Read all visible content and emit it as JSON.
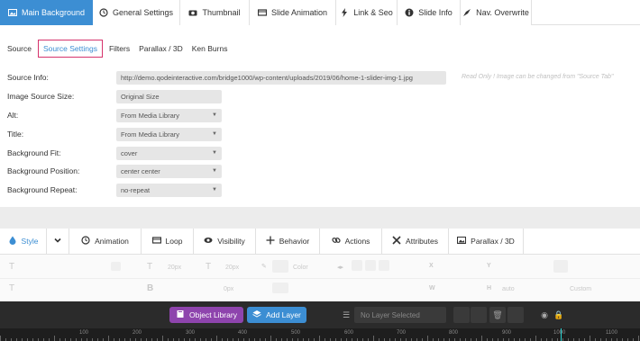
{
  "top_tabs": [
    {
      "label": "Main Background",
      "icon": "image-icon",
      "width": 103,
      "active": true
    },
    {
      "label": "General Settings",
      "icon": "history-icon",
      "width": 97
    },
    {
      "label": "Thumbnail",
      "icon": "camera-icon",
      "width": 77
    },
    {
      "label": "Slide Animation",
      "icon": "film-icon",
      "width": 96
    },
    {
      "label": "Link & Seo",
      "icon": "bolt-icon",
      "width": 68
    },
    {
      "label": "Slide Info",
      "icon": "info-icon",
      "width": 70
    },
    {
      "label": "Nav. Overwrite",
      "icon": "compass-icon",
      "width": 79
    }
  ],
  "sub_tabs": [
    "Source",
    "Source Settings",
    "Filters",
    "Parallax / 3D",
    "Ken Burns"
  ],
  "source_info": {
    "label": "Source Info:",
    "value": "http://demo.qodeinteractive.com/bridge1000/wp-content/uploads/2019/06/home-1-slider-img-1.jpg",
    "note": "Read Only ! Image can be changed from \"Source Tab\""
  },
  "fields": [
    {
      "label": "Image Source Size:",
      "value": "Original Size"
    },
    {
      "label": "Alt:",
      "value": "From Media Library"
    },
    {
      "label": "Title:",
      "value": "From Media Library"
    },
    {
      "label": "Background Fit:",
      "value": "cover"
    },
    {
      "label": "Background Position:",
      "value": "center center"
    },
    {
      "label": "Background Repeat:",
      "value": "no-repeat"
    }
  ],
  "layer_tabs": [
    {
      "label": "Style",
      "icon": "drop-icon",
      "active": true
    },
    {
      "label": "",
      "icon": "chevron-down-icon"
    },
    {
      "label": "Animation",
      "icon": "history-icon"
    },
    {
      "label": "Loop",
      "icon": "film-icon"
    },
    {
      "label": "Visibility",
      "icon": "eye-icon"
    },
    {
      "label": "Behavior",
      "icon": "move-icon"
    },
    {
      "label": "Actions",
      "icon": "link-icon"
    },
    {
      "label": "Attributes",
      "icon": "tools-icon"
    },
    {
      "label": "Parallax / 3D",
      "icon": "image-icon"
    }
  ],
  "toolbar_faded": {
    "size": "20px",
    "color": "Color",
    "x": "X",
    "y": "Y",
    "b": "B",
    "w": "W",
    "h": "H",
    "zero": "0px",
    "auto": "auto",
    "custom": "Custom"
  },
  "bottom_bar": {
    "object_library": "Object Library",
    "add_layer": "Add Layer",
    "layer_select": "No Layer Selected"
  },
  "ruler_numbers": [
    "100",
    "200",
    "300",
    "400",
    "500",
    "600",
    "700",
    "800",
    "900",
    "1000",
    "1100"
  ],
  "colors": {
    "accent": "#3c8ed3",
    "purple": "#8e44ad",
    "highlight": "#d6336c",
    "dark": "#2b2b2b"
  }
}
